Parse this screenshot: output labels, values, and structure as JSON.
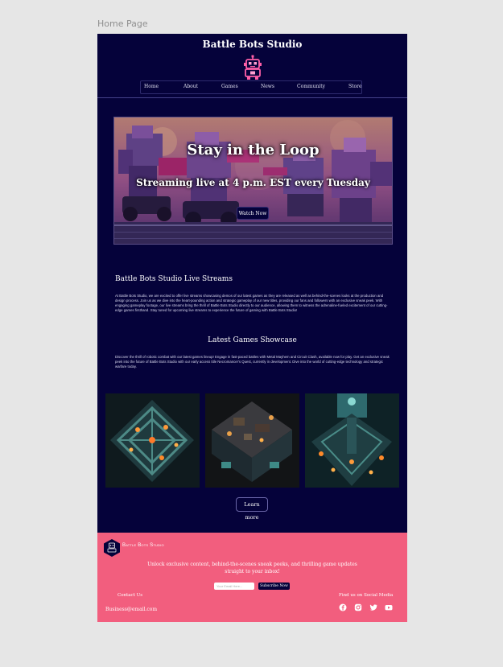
{
  "canvas": {
    "frame_label": "Home Page"
  },
  "header": {
    "title": "Battle Bots Studio",
    "nav": [
      "Home",
      "About",
      "Games",
      "News",
      "Community",
      "Store"
    ]
  },
  "hero": {
    "title": "Stay in the Loop",
    "subtitle": "Streaming live at 4 p.m. EST every Tuesday",
    "button": "Watch Now"
  },
  "live_streams": {
    "title": "Battle Bots Studio Live Streams",
    "body": "At Battle Bots Studio, we are excited to offer live streams showcasing demos of our latest games as they are released as well as behind-the-scenes looks at the production and design process. Join us as we dive into the heart-pounding action and strategic gameplay of our new titles, providing our fans and followers with an exclusive sneak peek. With engaging gameplay footage, our live streams bring the thrill of Battle Bots Studio directly to our audience, allowing them to witness the adrenaline-fueled excitement of our cutting-edge games firsthand. Stay tuned for upcoming live streams to experience the future of gaming with Battle Bots Studio!"
  },
  "showcase": {
    "title": "Latest Games Showcase",
    "body": "Discover the thrill of robotic combat with our latest games lineup! Engage in fast-paced battles with Metal Mayhem and Circuit Clash, available now for play. Get an exclusive sneak peek into the future of Battle Bots Studio with our early access title Necromancer's Quest, currently in development. Dive into the world of cutting-edge technology and strategic warfare today.",
    "button": "Learn more"
  },
  "footer": {
    "brand": "Battle Bots Studio",
    "promo": "Unlock exclusive content, behind-the-scenes sneak peeks, and thrilling game updates straight to your inbox!",
    "email_placeholder": "Your Email Here...",
    "subscribe": "Subscribe Now",
    "contact_title": "Contact Us",
    "contact_email": "Business@email.com",
    "social_title": "Find us on Social Media",
    "social": [
      "facebook-icon",
      "instagram-icon",
      "twitter-icon",
      "youtube-icon"
    ]
  },
  "colors": {
    "background": "#05023a",
    "footer": "#f25e7e",
    "accent_pink": "#ff5fa8",
    "canvas": "#e6e6e6"
  }
}
